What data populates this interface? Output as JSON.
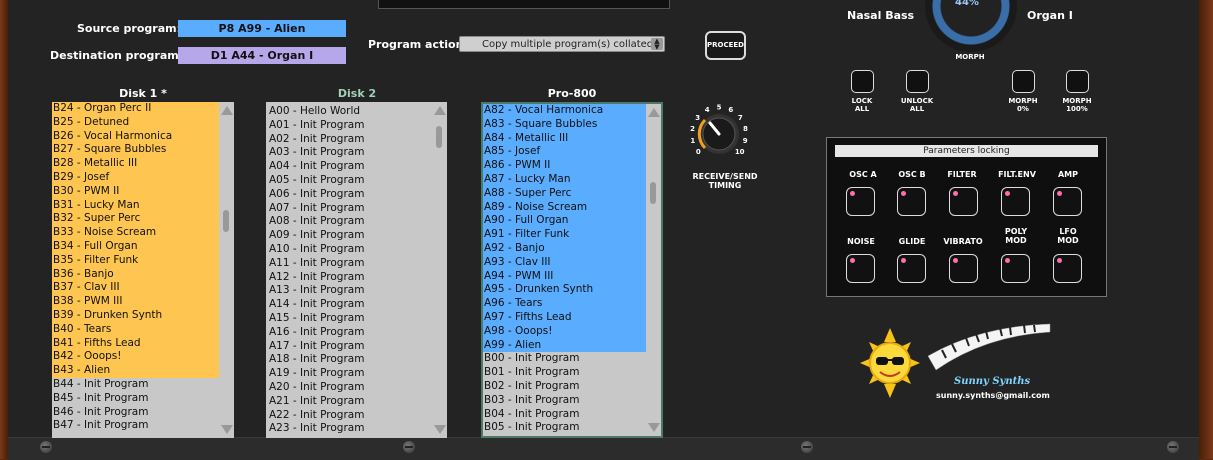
{
  "header": {
    "source_label": "Source program:",
    "source_value": "P8 A99 - Alien",
    "dest_label": "Destination program:",
    "dest_value": "D1 A44 - Organ I",
    "action_label": "Program action:",
    "action_value": "Copy multiple program(s) collated",
    "proceed_label": "PROCEED"
  },
  "lists": [
    {
      "title": "Disk 1 *",
      "title_color": "#ffffff",
      "highlight": "orange",
      "highlight_count": 20,
      "items": [
        "B24 - Organ Perc II",
        "B25 - Detuned",
        "B26 - Vocal Harmonica",
        "B27 - Square Bubbles",
        "B28 - Metallic III",
        "B29 - Josef",
        "B30 - PWM II",
        "B31 - Lucky Man",
        "B32 - Super Perc",
        "B33 - Noise Scream",
        "B34 - Full Organ",
        "B35 - Filter Funk",
        "B36 - Banjo",
        "B37 - Clav III",
        "B38 - PWM III",
        "B39 - Drunken Synth",
        "B40 - Tears",
        "B41 - Fifths Lead",
        "B42 - Ooops!",
        "B43 - Alien",
        "B44 - Init Program",
        "B45 - Init Program",
        "B46 - Init Program",
        "B47 - Init Program"
      ]
    },
    {
      "title": "Disk 2",
      "title_color": "#9fd0b8",
      "highlight": "none",
      "highlight_count": 0,
      "items": [
        "A00 - Hello World",
        "A01 - Init Program",
        "A02 - Init Program",
        "A03 - Init Program",
        "A04 - Init Program",
        "A05 - Init Program",
        "A06 - Init Program",
        "A07 - Init Program",
        "A08 - Init Program",
        "A09 - Init Program",
        "A10 - Init Program",
        "A11 - Init Program",
        "A12 - Init Program",
        "A13 - Init Program",
        "A14 - Init Program",
        "A15 - Init Program",
        "A16 - Init Program",
        "A17 - Init Program",
        "A18 - Init Program",
        "A19 - Init Program",
        "A20 - Init Program",
        "A21 - Init Program",
        "A22 - Init Program",
        "A23 - Init Program"
      ]
    },
    {
      "title": "Pro-800",
      "title_color": "#ffffff",
      "highlight": "blue",
      "highlight_count": 18,
      "items": [
        "A82 - Vocal Harmonica",
        "A83 - Square Bubbles",
        "A84 - Metallic III",
        "A85 - Josef",
        "A86 - PWM II",
        "A87 - Lucky Man",
        "A88 - Super Perc",
        "A89 - Noise Scream",
        "A90 - Full Organ",
        "A91 - Filter Funk",
        "A92 - Banjo",
        "A93 - Clav III",
        "A94 - PWM III",
        "A95 - Drunken Synth",
        "A96 - Tears",
        "A97 - Fifths Lead",
        "A98 - Ooops!",
        "A99 - Alien",
        "B00 - Init Program",
        "B01 - Init Program",
        "B02 - Init Program",
        "B03 - Init Program",
        "B04 - Init Program",
        "B05 - Init Program"
      ]
    }
  ],
  "timing_knob": {
    "label_line1": "RECEIVE/SEND",
    "label_line2": "TIMING",
    "scale": [
      "0",
      "1",
      "2",
      "3",
      "4",
      "5",
      "6",
      "7",
      "8",
      "9",
      "10"
    ]
  },
  "morph": {
    "left_program": "Nasal Bass",
    "right_program": "Organ I",
    "knob_label": "MORPH",
    "knob_readout": "44%"
  },
  "morph_buttons": [
    {
      "line1": "LOCK",
      "line2": "ALL"
    },
    {
      "line1": "UNLOCK",
      "line2": "ALL"
    },
    {
      "line1": "MORPH",
      "line2": "0%"
    },
    {
      "line1": "MORPH",
      "line2": "100%"
    }
  ],
  "params": {
    "title": "Parameters locking",
    "row1": [
      {
        "line1": "OSC A",
        "line2": ""
      },
      {
        "line1": "OSC B",
        "line2": ""
      },
      {
        "line1": "FILTER",
        "line2": ""
      },
      {
        "line1": "FILT.ENV",
        "line2": ""
      },
      {
        "line1": "AMP",
        "line2": ""
      }
    ],
    "row2": [
      {
        "line1": "NOISE",
        "line2": ""
      },
      {
        "line1": "GLIDE",
        "line2": ""
      },
      {
        "line1": "VIBRATO",
        "line2": ""
      },
      {
        "line1": "POLY",
        "line2": "MOD"
      },
      {
        "line1": "LFO",
        "line2": "MOD"
      }
    ]
  },
  "brand": {
    "name": "Sunny Synths",
    "email": "sunny.synths@gmail.com"
  },
  "colors": {
    "source_bg": "#5aacff",
    "dest_bg": "#b5a7e9",
    "orange_highlight": "#fec650",
    "blue_highlight": "#5aacff",
    "led_pink": "#ff6fae"
  }
}
